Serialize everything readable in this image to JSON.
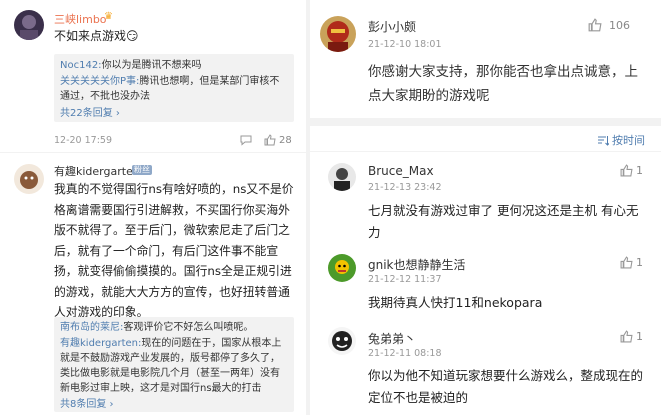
{
  "left": {
    "comment1": {
      "user": "三峡limbo",
      "text": "不如来点游戏😏",
      "replies": [
        {
          "name": "Noc142:",
          "text": "你以为是腾讯不想来吗"
        },
        {
          "name": "关关关关关你P事:",
          "text": "腾讯也想啊，但是某部门审核不通过，不批也没办法"
        }
      ],
      "more": "共22条回复 ›",
      "time": "12-20 17:59",
      "likes": "28"
    },
    "comment2": {
      "user": "有趣kidergarten",
      "badge": "粉丝",
      "text": "我真的不觉得国行ns有啥好喷的，ns又不是价格离谱需要国行引进解救，不买国行你买海外版不就得了。至于后门，微软索尼走了后门之后，就有了一个命门，有后门这件事不能宣扬，就变得偷偷摸摸的。国行ns全是正规引进的游戏，就能大大方方的宣传，也好扭转普通人对游戏的印象。",
      "replies": [
        {
          "name": "南布岛的莱尼:",
          "text": "客观评价它不好怎么叫喷呢。"
        },
        {
          "name": "有趣kidergarten:",
          "text": "现在的问题在于，国家从根本上就是不鼓励游戏产业发展的，版号都停了多久了，类比做电影就是电影院几个月（甚至一两年）没有新电影过审上映，这才是对国行ns最大的打击"
        }
      ],
      "more": "共8条回复 ›"
    }
  },
  "right": {
    "top": {
      "user": "彭小小颇",
      "time": "21-12-10 18:01",
      "likes": "106",
      "text": "你感谢大家支持，那你能否也拿出点诚意，上点大家期盼的游戏呢"
    },
    "sort_label": "按时间",
    "comments": [
      {
        "user": "Bruce_Max",
        "time": "21-12-13 23:42",
        "likes": "1",
        "text": "七月就没有游戏过审了 更何况这还是主机 有心无力"
      },
      {
        "user": "gnik也想静静生活",
        "time": "21-12-12 11:37",
        "likes": "1",
        "text": "我期待真人快打11和nekopara"
      },
      {
        "user": "兔弟弟丶",
        "time": "21-12-11 08:18",
        "likes": "1",
        "text": "你以为他不知道玩家想要什么游戏么，整成现在的定位不也是被迫的"
      }
    ]
  },
  "colors": {
    "link": "#507daf",
    "orange_name": "#eb7350",
    "meta": "#999999"
  }
}
